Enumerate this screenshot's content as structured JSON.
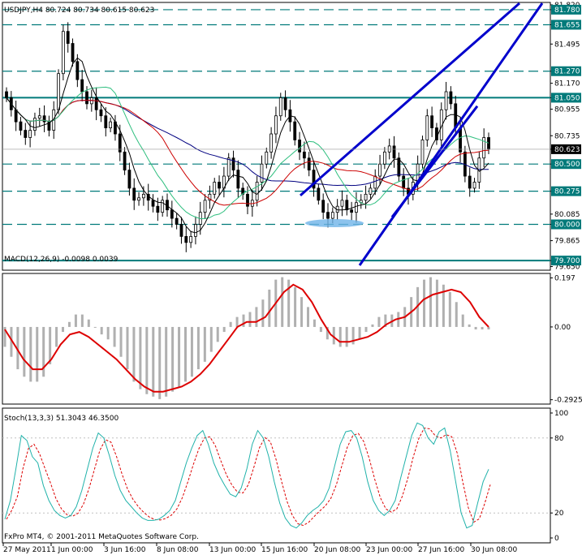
{
  "header": {
    "main_info": "USDJPY,H4  80.724 80.734 80.615 80.623",
    "macd_info": "MACD(12,26,9) -0.0098 0.0039",
    "stoch_info": "Stoch(13,3,3) 51.3043 46.3500",
    "copyright": "FxPro MT4, © 2001-2011 MetaQuotes Software Corp."
  },
  "colors": {
    "background": "#ffffff",
    "grid": "#000000",
    "candle": "#000000",
    "tag_bg": "#007a7a",
    "tag_fg": "#ffffff",
    "price_tag_bg": "#000000",
    "trendline": "#0000cc",
    "level_line": "#007a7a",
    "ma_black": "#000000",
    "ma_green": "#2fbf7f",
    "ma_red": "#cc0000",
    "ma_navy": "#000080",
    "ellipse": "#6fb4e8",
    "macd_hist": "#b0b0b0",
    "macd_signal": "#dd0000",
    "stoch_main": "#20b2aa",
    "stoch_signal": "#dd0000"
  },
  "chart_data": [
    {
      "type": "candlestick",
      "symbol": "USDJPY",
      "timeframe": "H4",
      "ohlc_last": {
        "open": 80.724,
        "high": 80.734,
        "low": 80.615,
        "close": 80.623
      },
      "ylim": [
        79.62,
        81.84
      ],
      "price_labels": [
        "81.820",
        "81.780",
        "81.655",
        "81.495",
        "81.270",
        "81.170",
        "81.050",
        "80.955",
        "80.735",
        "80.623",
        "80.500",
        "80.275",
        "80.085",
        "80.000",
        "79.865",
        "79.700",
        "79.650"
      ],
      "levels": [
        {
          "value": 81.78,
          "style": "dashed"
        },
        {
          "value": 81.655,
          "style": "dashed"
        },
        {
          "value": 81.27,
          "style": "dashed"
        },
        {
          "value": 81.05,
          "style": "solid"
        },
        {
          "value": 80.5,
          "style": "dashed"
        },
        {
          "value": 80.275,
          "style": "dashed"
        },
        {
          "value": 80.0,
          "style": "dashed"
        },
        {
          "value": 79.7,
          "style": "solid"
        }
      ],
      "tagged_levels": [
        "81.780",
        "81.655",
        "81.270",
        "81.050",
        "80.500",
        "80.275",
        "80.000",
        "79.700"
      ],
      "current_price_tag": "80.623",
      "close_series": [
        81.05,
        80.95,
        80.85,
        80.78,
        80.72,
        80.78,
        80.88,
        80.9,
        80.85,
        80.78,
        80.95,
        81.25,
        81.6,
        81.5,
        81.35,
        81.2,
        81.1,
        81.0,
        81.05,
        80.95,
        80.9,
        80.8,
        80.85,
        80.75,
        80.6,
        80.45,
        80.3,
        80.2,
        80.22,
        80.25,
        80.2,
        80.15,
        80.1,
        80.2,
        80.12,
        80.05,
        80.0,
        79.9,
        79.85,
        79.9,
        80.0,
        80.1,
        80.2,
        80.25,
        80.35,
        80.3,
        80.4,
        80.55,
        80.45,
        80.3,
        80.25,
        80.15,
        80.2,
        80.35,
        80.5,
        80.6,
        80.75,
        80.9,
        81.05,
        80.95,
        80.85,
        80.7,
        80.6,
        80.55,
        80.45,
        80.3,
        80.2,
        80.1,
        80.05,
        80.1,
        80.15,
        80.2,
        80.12,
        80.1,
        80.18,
        80.2,
        80.25,
        80.3,
        80.4,
        80.5,
        80.6,
        80.65,
        80.55,
        80.4,
        80.3,
        80.25,
        80.35,
        80.5,
        80.7,
        80.9,
        80.8,
        80.7,
        80.95,
        81.1,
        81.0,
        80.8,
        80.6,
        80.4,
        80.3,
        80.35,
        80.55,
        80.72,
        80.623
      ]
    },
    {
      "type": "line",
      "name": "MACD(12,26,9)",
      "values_label": "-0.0098 0.0039",
      "ylim": [
        -0.31,
        0.215
      ],
      "tick_labels": [
        "0.197",
        "0.00",
        "-0.2925"
      ],
      "histogram": [
        -0.08,
        -0.12,
        -0.17,
        -0.2,
        -0.22,
        -0.22,
        -0.2,
        -0.15,
        -0.08,
        -0.02,
        0.02,
        0.05,
        0.05,
        0.03,
        0.0,
        -0.03,
        -0.05,
        -0.08,
        -0.12,
        -0.17,
        -0.22,
        -0.25,
        -0.27,
        -0.28,
        -0.29,
        -0.28,
        -0.26,
        -0.24,
        -0.22,
        -0.2,
        -0.17,
        -0.14,
        -0.1,
        -0.06,
        -0.02,
        0.02,
        0.04,
        0.05,
        0.06,
        0.08,
        0.11,
        0.15,
        0.19,
        0.2,
        0.19,
        0.16,
        0.12,
        0.08,
        0.03,
        -0.02,
        -0.05,
        -0.07,
        -0.08,
        -0.08,
        -0.07,
        -0.05,
        -0.02,
        0.01,
        0.04,
        0.05,
        0.05,
        0.06,
        0.08,
        0.12,
        0.16,
        0.19,
        0.2,
        0.19,
        0.17,
        0.14,
        0.1,
        0.05,
        0.01,
        -0.01,
        -0.01,
        -0.01
      ],
      "signal": [
        -0.01,
        -0.07,
        -0.13,
        -0.17,
        -0.17,
        -0.13,
        -0.07,
        -0.03,
        -0.02,
        -0.04,
        -0.07,
        -0.1,
        -0.13,
        -0.17,
        -0.21,
        -0.24,
        -0.26,
        -0.26,
        -0.25,
        -0.24,
        -0.22,
        -0.19,
        -0.15,
        -0.1,
        -0.05,
        0.0,
        0.02,
        0.02,
        0.04,
        0.09,
        0.14,
        0.17,
        0.15,
        0.1,
        0.03,
        -0.03,
        -0.06,
        -0.06,
        -0.05,
        -0.04,
        -0.02,
        0.01,
        0.03,
        0.04,
        0.07,
        0.11,
        0.13,
        0.14,
        0.15,
        0.14,
        0.1,
        0.04,
        0.0
      ]
    },
    {
      "type": "line",
      "name": "Stoch(13,3,3)",
      "values_label": "51.3043 46.3500",
      "ylim": [
        0,
        100
      ],
      "tick_labels": [
        "100",
        "80",
        "20",
        "0"
      ],
      "main": [
        15,
        30,
        55,
        82,
        78,
        65,
        60,
        42,
        30,
        22,
        18,
        16,
        18,
        25,
        38,
        55,
        72,
        84,
        80,
        66,
        50,
        38,
        30,
        25,
        20,
        16,
        14,
        14,
        15,
        18,
        22,
        30,
        45,
        60,
        72,
        82,
        86,
        75,
        60,
        50,
        42,
        35,
        33,
        40,
        55,
        75,
        86,
        80,
        65,
        45,
        28,
        16,
        10,
        8,
        12,
        18,
        22,
        25,
        30,
        40,
        58,
        75,
        85,
        86,
        80,
        65,
        45,
        30,
        22,
        18,
        22,
        30,
        48,
        65,
        82,
        92,
        90,
        80,
        75,
        85,
        88,
        70,
        45,
        20,
        8,
        10,
        28,
        45,
        55
      ]
    }
  ],
  "x_axis": {
    "labels": [
      "27 May 2011",
      "1 Jun 00:00",
      "3 Jun 16:00",
      "8 Jun 08:00",
      "13 Jun 00:00",
      "15 Jun 16:00",
      "20 Jun 08:00",
      "23 Jun 00:00",
      "27 Jun 16:00",
      "30 Jun 08:00"
    ]
  }
}
